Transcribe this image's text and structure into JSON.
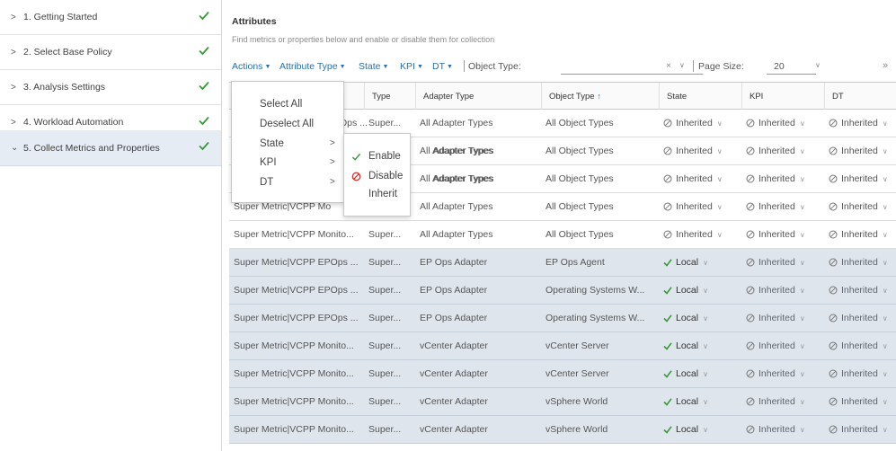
{
  "nav": {
    "items": [
      {
        "label": "1. Getting Started",
        "chevron": ">"
      },
      {
        "label": "2. Select Base Policy",
        "chevron": ">"
      },
      {
        "label": "3. Analysis Settings",
        "chevron": ">"
      },
      {
        "label": "4. Workload Automation",
        "chevron": ">"
      },
      {
        "label": "5. Collect Metrics and Properties",
        "chevron": "⌄"
      }
    ],
    "check_color": "#3a9a3a"
  },
  "main": {
    "title": "Attributes",
    "subtitle": "Find metrics or properties below and enable or disable them for collection"
  },
  "toolbar": {
    "actions": "Actions",
    "attribute_type": "Attribute Type",
    "state": "State",
    "kpi": "KPI",
    "dt": "DT",
    "object_type_label": "Object Type:",
    "object_type_value": "",
    "clear": "×",
    "page_size_label": "Page Size:",
    "page_size_value": "20",
    "more": "»"
  },
  "table": {
    "headers": {
      "type": "Type",
      "adapter_type": "Adapter Type",
      "object_type": "Object Type",
      "state": "State",
      "kpi": "KPI",
      "dt": "DT"
    },
    "sort_icon": "↑",
    "rows": [
      {
        "name": "",
        "type": "Super...",
        "adapter": "All Adapter Types",
        "object_type": "All Object Types",
        "state": "Inherited",
        "kpi": "Inherited",
        "dt": "Inherited",
        "selected": false
      },
      {
        "name": "",
        "type": "",
        "adapter": "All Adapter Types",
        "object_type": "All Object Types",
        "state": "Inherited",
        "kpi": "Inherited",
        "dt": "Inherited",
        "selected": false
      },
      {
        "name": "",
        "type": "",
        "adapter": "All Adapter Types",
        "object_type": "All Object Types",
        "state": "Inherited",
        "kpi": "Inherited",
        "dt": "Inherited",
        "selected": false
      },
      {
        "name": "Super Metric|VCPP Mo",
        "type": "",
        "adapter": "All Adapter Types",
        "object_type": "All Object Types",
        "state": "Inherited",
        "kpi": "Inherited",
        "dt": "Inherited",
        "selected": false
      },
      {
        "name": "Super Metric|VCPP Monito...",
        "type": "Super...",
        "adapter": "All Adapter Types",
        "object_type": "All Object Types",
        "state": "Inherited",
        "kpi": "Inherited",
        "dt": "Inherited",
        "selected": false
      },
      {
        "name": "Super Metric|VCPP EPOps ...",
        "type": "Super...",
        "adapter": "EP Ops Adapter",
        "object_type": "EP Ops Agent",
        "state": "Local",
        "kpi": "Inherited",
        "dt": "Inherited",
        "selected": true
      },
      {
        "name": "Super Metric|VCPP EPOps ...",
        "type": "Super...",
        "adapter": "EP Ops Adapter",
        "object_type": "Operating Systems W...",
        "state": "Local",
        "kpi": "Inherited",
        "dt": "Inherited",
        "selected": true
      },
      {
        "name": "Super Metric|VCPP EPOps ...",
        "type": "Super...",
        "adapter": "EP Ops Adapter",
        "object_type": "Operating Systems W...",
        "state": "Local",
        "kpi": "Inherited",
        "dt": "Inherited",
        "selected": true
      },
      {
        "name": "Super Metric|VCPP Monito...",
        "type": "Super...",
        "adapter": "vCenter Adapter",
        "object_type": "vCenter Server",
        "state": "Local",
        "kpi": "Inherited",
        "dt": "Inherited",
        "selected": true
      },
      {
        "name": "Super Metric|VCPP Monito...",
        "type": "Super...",
        "adapter": "vCenter Adapter",
        "object_type": "vCenter Server",
        "state": "Local",
        "kpi": "Inherited",
        "dt": "Inherited",
        "selected": true
      },
      {
        "name": "Super Metric|VCPP Monito...",
        "type": "Super...",
        "adapter": "vCenter Adapter",
        "object_type": "vSphere World",
        "state": "Local",
        "kpi": "Inherited",
        "dt": "Inherited",
        "selected": true
      },
      {
        "name": "Super Metric|VCPP Monito...",
        "type": "Super...",
        "adapter": "vCenter Adapter",
        "object_type": "vSphere World",
        "state": "Local",
        "kpi": "Inherited",
        "dt": "Inherited",
        "selected": true
      }
    ],
    "row0_partial_name": "Ops ...",
    "row1_partial_adapter": "Adapter Types",
    "row2_partial_adapter": "Adapter Types"
  },
  "actions_menu": {
    "items": [
      {
        "label": "Select All"
      },
      {
        "label": "Deselect All"
      },
      {
        "label": "State",
        "submenu": ">"
      },
      {
        "label": "KPI",
        "submenu": ">"
      },
      {
        "label": "DT",
        "submenu": ">"
      }
    ]
  },
  "state_submenu": {
    "items": [
      {
        "label": "Enable",
        "icon": "check-icon"
      },
      {
        "label": "Disable",
        "icon": "disabled-icon"
      },
      {
        "label": "Inherit",
        "icon": ""
      }
    ]
  },
  "colors": {
    "accent": "#2c6fad",
    "selected_row": "#dfe5ec",
    "active_nav": "#e6ecf3",
    "check_green": "#3a9a3a",
    "disable_red": "#c9302c"
  }
}
